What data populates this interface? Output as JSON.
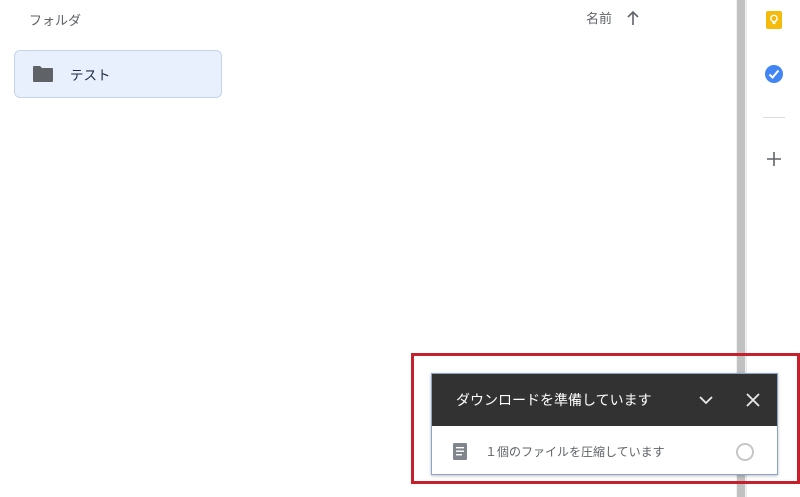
{
  "main": {
    "section_label": "フォルダ",
    "sort": {
      "label": "名前",
      "direction_icon": "arrow-up-icon"
    },
    "folders": [
      {
        "name": "テスト",
        "icon": "folder-icon"
      }
    ]
  },
  "side_panel": {
    "icons": [
      "keep-icon",
      "tasks-icon",
      "add-addon-icon"
    ]
  },
  "download_panel": {
    "title": "ダウンロードを準備しています",
    "status": "１個のファイルを圧縮しています",
    "icons": [
      "chevron-down-icon",
      "close-icon",
      "document-icon"
    ]
  },
  "colors": {
    "header_bg": "#323232",
    "folder_tile_bg": "#e8f0fe",
    "highlight": "#c5202c",
    "keep_yellow": "#f6bb0a",
    "tasks_blue": "#4285f4"
  }
}
